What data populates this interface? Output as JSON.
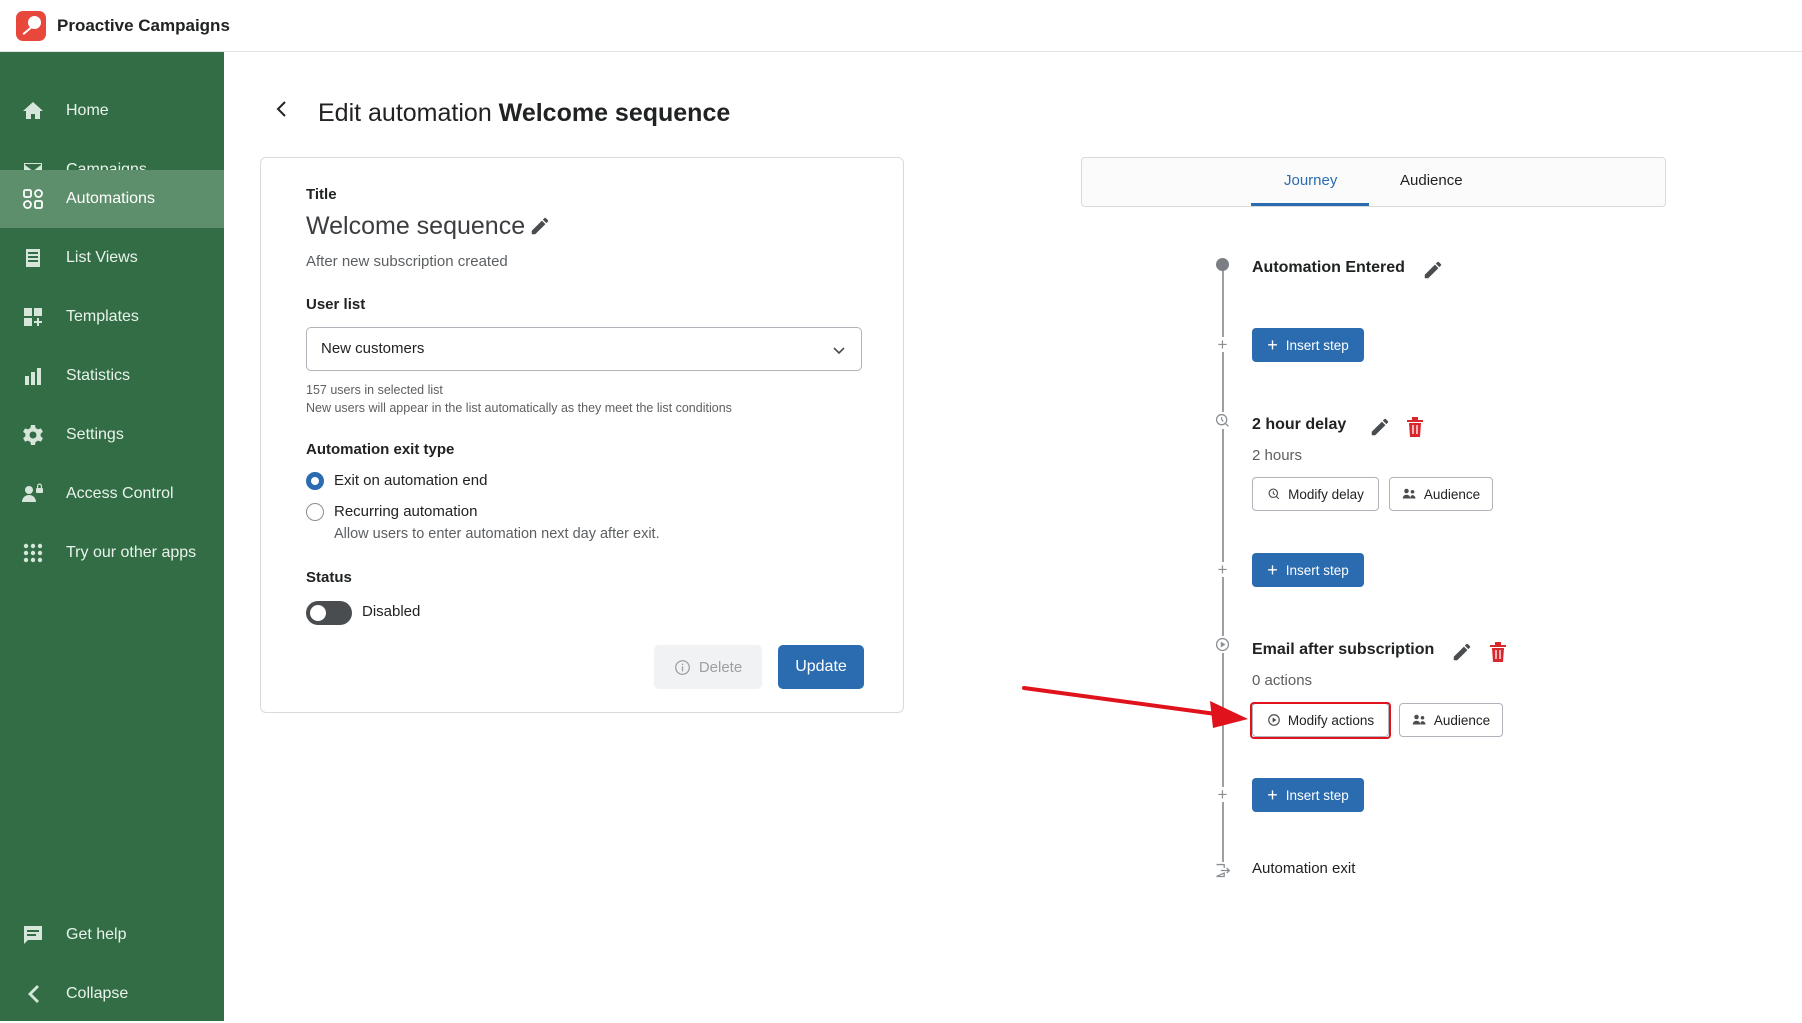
{
  "app": {
    "title": "Proactive Campaigns"
  },
  "sidebar": {
    "items": [
      {
        "label": "Home",
        "icon": "home-icon"
      },
      {
        "label": "Campaigns",
        "icon": "mail-icon"
      },
      {
        "label": "Automations",
        "icon": "automations-icon",
        "active": true
      },
      {
        "label": "List Views",
        "icon": "list-icon"
      },
      {
        "label": "Templates",
        "icon": "templates-icon"
      },
      {
        "label": "Statistics",
        "icon": "bar-chart-icon"
      },
      {
        "label": "Settings",
        "icon": "gear-icon"
      },
      {
        "label": "Access Control",
        "icon": "users-icon"
      },
      {
        "label": "Try our other apps",
        "icon": "apps-grid-icon"
      }
    ],
    "bottom": [
      {
        "label": "Get help",
        "icon": "chat-icon"
      },
      {
        "label": "Collapse",
        "icon": "chevron-left-icon"
      }
    ]
  },
  "header": {
    "prefix": "Edit automation",
    "name": "Welcome sequence"
  },
  "form": {
    "title_label": "Title",
    "title_value": "Welcome sequence",
    "title_subtitle": "After new subscription created",
    "user_list_label": "User list",
    "user_list_value": "New customers",
    "user_list_help1": "157 users in selected list",
    "user_list_help2": "New users will appear in the list automatically as they meet the list conditions",
    "exit_type_label": "Automation exit type",
    "exit_options": [
      {
        "label": "Exit on automation end",
        "checked": true
      },
      {
        "label": "Recurring automation",
        "checked": false
      }
    ],
    "recurring_help": "Allow users to enter automation next day after exit.",
    "status_label": "Status",
    "status_value": "Disabled",
    "delete_label": "Delete",
    "update_label": "Update"
  },
  "tabs": {
    "journey": "Journey",
    "audience": "Audience"
  },
  "journey": {
    "entered_title": "Automation Entered",
    "insert_label": "Insert step",
    "delay_title": "2 hour delay",
    "delay_sub": "2 hours",
    "modify_delay_label": "Modify delay",
    "audience_label": "Audience",
    "email_title": "Email after subscription",
    "email_sub": "0 actions",
    "modify_actions_label": "Modify actions",
    "exit_label": "Automation exit"
  },
  "colors": {
    "sidebar": "#326d45",
    "sidebar_active": "#5e8f6c",
    "primary": "#2b6cb0",
    "danger": "#e0121b"
  }
}
